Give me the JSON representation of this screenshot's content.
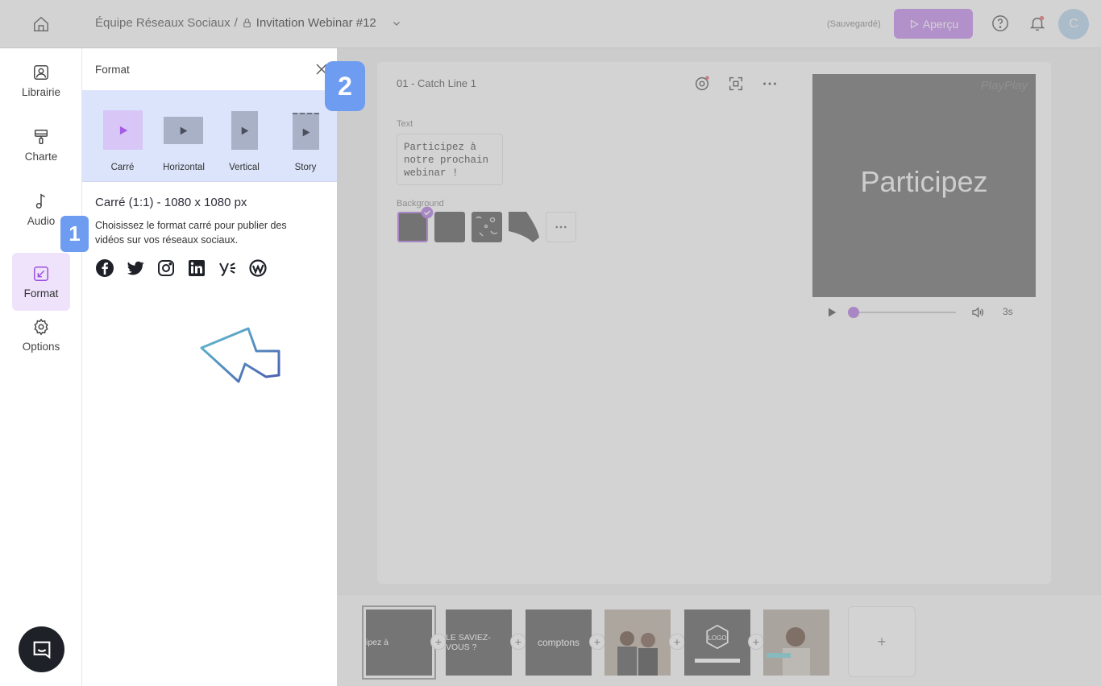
{
  "header": {
    "breadcrumb_team": "Équipe Réseaux Sociaux",
    "breadcrumb_sep": "/",
    "breadcrumb_project": "Invitation Webinar #12",
    "saved_status": "(Sauvegardé)",
    "preview_label": "Aperçu",
    "avatar_initial": "C"
  },
  "rail": {
    "items": [
      {
        "label": "Librairie",
        "icon": "image-icon"
      },
      {
        "label": "Charte",
        "icon": "paint-roller-icon"
      },
      {
        "label": "Audio",
        "icon": "music-note-icon"
      },
      {
        "label": "Format",
        "icon": "resize-icon",
        "active": true
      },
      {
        "label": "Options",
        "icon": "gear-icon"
      }
    ]
  },
  "panel": {
    "title": "Format",
    "formats": [
      {
        "label": "Carré",
        "selected": true
      },
      {
        "label": "Horizontal"
      },
      {
        "label": "Vertical"
      },
      {
        "label": "Story"
      }
    ],
    "selected_title": "Carré (1:1) - 1080 x 1080 px",
    "selected_description": "Choisissez le format carré pour publier des vidéos sur vos réseaux sociaux.",
    "socials": [
      "facebook-icon",
      "twitter-icon",
      "instagram-icon",
      "linkedin-icon",
      "yammer-icon",
      "workplace-icon"
    ]
  },
  "badges": {
    "one": "1",
    "two": "2"
  },
  "editor": {
    "scene_title": "01 - Catch Line 1",
    "text_label": "Text",
    "text_value": "Participez à\nnotre prochain\nwebinar !",
    "background_label": "Background",
    "preview_text": "Participez",
    "preview_watermark": "PlayPlay",
    "duration": "3s",
    "timeline": [
      {
        "label": "ipez à",
        "selected": true
      },
      {
        "label": "LE SAVIEZ-VOUS ?"
      },
      {
        "label": "comptons"
      },
      {
        "label": ""
      },
      {
        "label": "LOGO"
      },
      {
        "label": ""
      }
    ],
    "add_scene": "+"
  },
  "colors": {
    "accent": "#c78cf0",
    "badge": "#6e9cf0",
    "format_strip": "#dbe4fa",
    "rail_active": "#efe3fb"
  }
}
